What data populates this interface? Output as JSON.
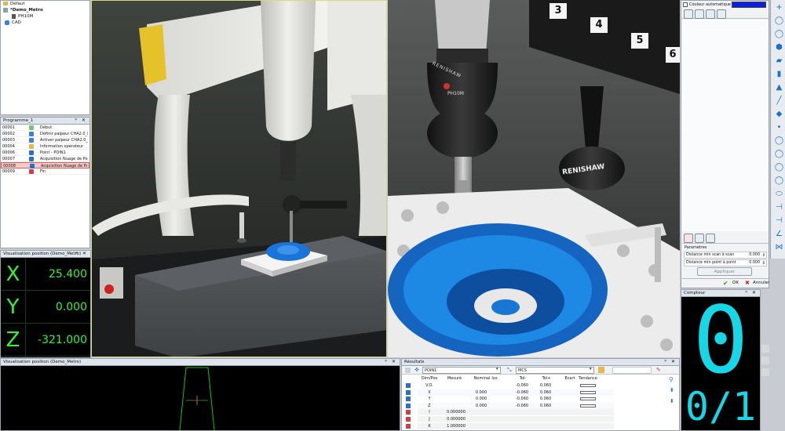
{
  "tree": {
    "items": [
      "Défaut",
      "*Demo_Metro",
      "PH10M",
      "CAD"
    ]
  },
  "programme": {
    "title": "Programme_1",
    "rows": [
      {
        "num": "00001",
        "label": "Début"
      },
      {
        "num": "00002",
        "label": "Définir palpeur CHA2.0_B0"
      },
      {
        "num": "00003",
        "label": "Activer palpeur CHA2.0_B0"
      },
      {
        "num": "00004",
        "label": "Information opérateur"
      },
      {
        "num": "00006",
        "label": "Point - POIN1"
      },
      {
        "num": "00007",
        "label": "Acquisition Nuage de Points"
      },
      {
        "num": "00008",
        "label": "Acquisition Nuage de Po"
      },
      {
        "num": "00009",
        "label": "Fin"
      }
    ]
  },
  "coords": {
    "title": "Visualisation position (Demo_Metro)",
    "rows": [
      {
        "axis": "X",
        "value": "25.400"
      },
      {
        "axis": "Y",
        "value": "0.000"
      },
      {
        "axis": "Z",
        "value": "-321.000"
      }
    ]
  },
  "bottom_view": {
    "title": "Visualisation position (Demo_Metro)"
  },
  "left_viewport": {
    "head_labels": []
  },
  "right_viewport": {
    "port_numbers": [
      "3",
      "4",
      "5",
      "6"
    ],
    "head_brand": "RENISHAW",
    "head_model": "PH10M",
    "probe_brand": "RENISHAW"
  },
  "right_panel": {
    "checkbox_label": "Couleur automatique",
    "accent_color": "#0a1ee8",
    "params_title": "Paramètres",
    "params": [
      {
        "label": "Distance min scan à scan",
        "value": "0.000"
      },
      {
        "label": "Distance min point à point",
        "value": "0.000"
      }
    ],
    "apply_label": "Appliquer",
    "ok_label": "OK",
    "cancel_label": "Annuler"
  },
  "compteur": {
    "title": "Compteur",
    "big_digit": "0",
    "fraction": "0/1",
    "digit_color": "#17d6e6"
  },
  "resultats": {
    "title": "Résultats",
    "feature_select": "POIN1",
    "ref_select": "MCS",
    "headers": [
      "Dim/Pos",
      "Mesuré",
      "Nominal",
      "Iso",
      "Tol-",
      "Tol+",
      "Ecart",
      "Tendance"
    ],
    "rows": [
      {
        "name": "V.O.",
        "measured": "",
        "nominal": "",
        "tol_minus": "-0.060",
        "tol_plus": "0.060"
      },
      {
        "name": "X",
        "measured": "",
        "nominal": "0.000",
        "tol_minus": "-0.060",
        "tol_plus": "0.060"
      },
      {
        "name": "Y",
        "measured": "",
        "nominal": "0.000",
        "tol_minus": "-0.060",
        "tol_plus": "0.060"
      },
      {
        "name": "Z",
        "measured": "",
        "nominal": "0.000",
        "tol_minus": "-0.060",
        "tol_plus": "0.060"
      },
      {
        "name": "I",
        "measured": "0.000000",
        "nominal": "",
        "tol_minus": "",
        "tol_plus": ""
      },
      {
        "name": "J",
        "measured": "0.000000",
        "nominal": "",
        "tol_minus": "",
        "tol_plus": ""
      },
      {
        "name": "K",
        "measured": "1.000000",
        "nominal": "",
        "tol_minus": "",
        "tol_plus": ""
      }
    ]
  },
  "toolbar_icons": [
    "plus-icon",
    "circle-icon",
    "circle-icon",
    "sphere-icon",
    "plane-icon",
    "cylinder-icon",
    "cone-icon",
    "line-icon",
    "surface-icon",
    "point-icon",
    "circle-icon",
    "circle-icon",
    "circle-icon",
    "circle-icon",
    "ellipse-icon",
    "distance-icon",
    "distance-icon",
    "angle-icon",
    "symmetry-icon"
  ]
}
